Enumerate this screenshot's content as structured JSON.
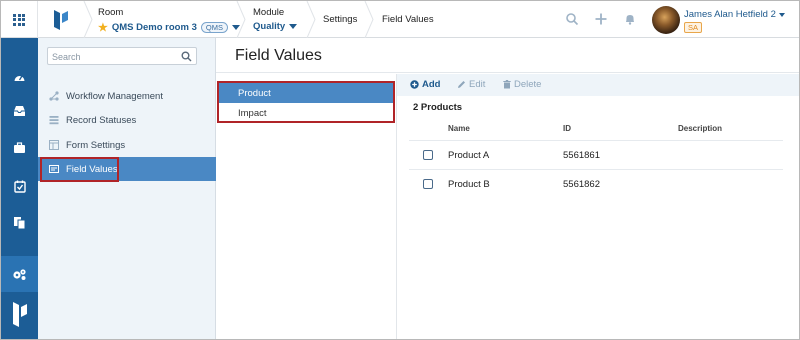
{
  "topbar": {
    "room_label": "Room",
    "room_value": "QMS Demo room 3",
    "room_badge": "QMS",
    "module_label": "Module",
    "module_value": "Quality",
    "settings_crumb": "Settings",
    "field_values_crumb": "Field Values",
    "user_name": "James Alan Hetfield 2",
    "user_role_badge": "SA"
  },
  "sidebar": {
    "search_placeholder": "Search",
    "items": [
      {
        "label": "Workflow Management",
        "icon": "workflow-icon"
      },
      {
        "label": "Record Statuses",
        "icon": "list-icon"
      },
      {
        "label": "Form Settings",
        "icon": "form-icon"
      },
      {
        "label": "Field Values",
        "icon": "field-values-icon"
      }
    ]
  },
  "main": {
    "title": "Field Values",
    "list": [
      "Product",
      "Impact"
    ],
    "toolbar": {
      "add": "Add",
      "edit": "Edit",
      "delete": "Delete"
    },
    "count": "2 Products",
    "columns": {
      "name": "Name",
      "id": "ID",
      "description": "Description"
    },
    "rows": [
      {
        "name": "Product A",
        "id": "5561861",
        "description": ""
      },
      {
        "name": "Product B",
        "id": "5561862",
        "description": ""
      }
    ]
  },
  "colors": {
    "accent": "#4a88c4",
    "rail": "#1c5d96",
    "highlight": "#b02428",
    "badge_orange": "#e08a1e"
  }
}
